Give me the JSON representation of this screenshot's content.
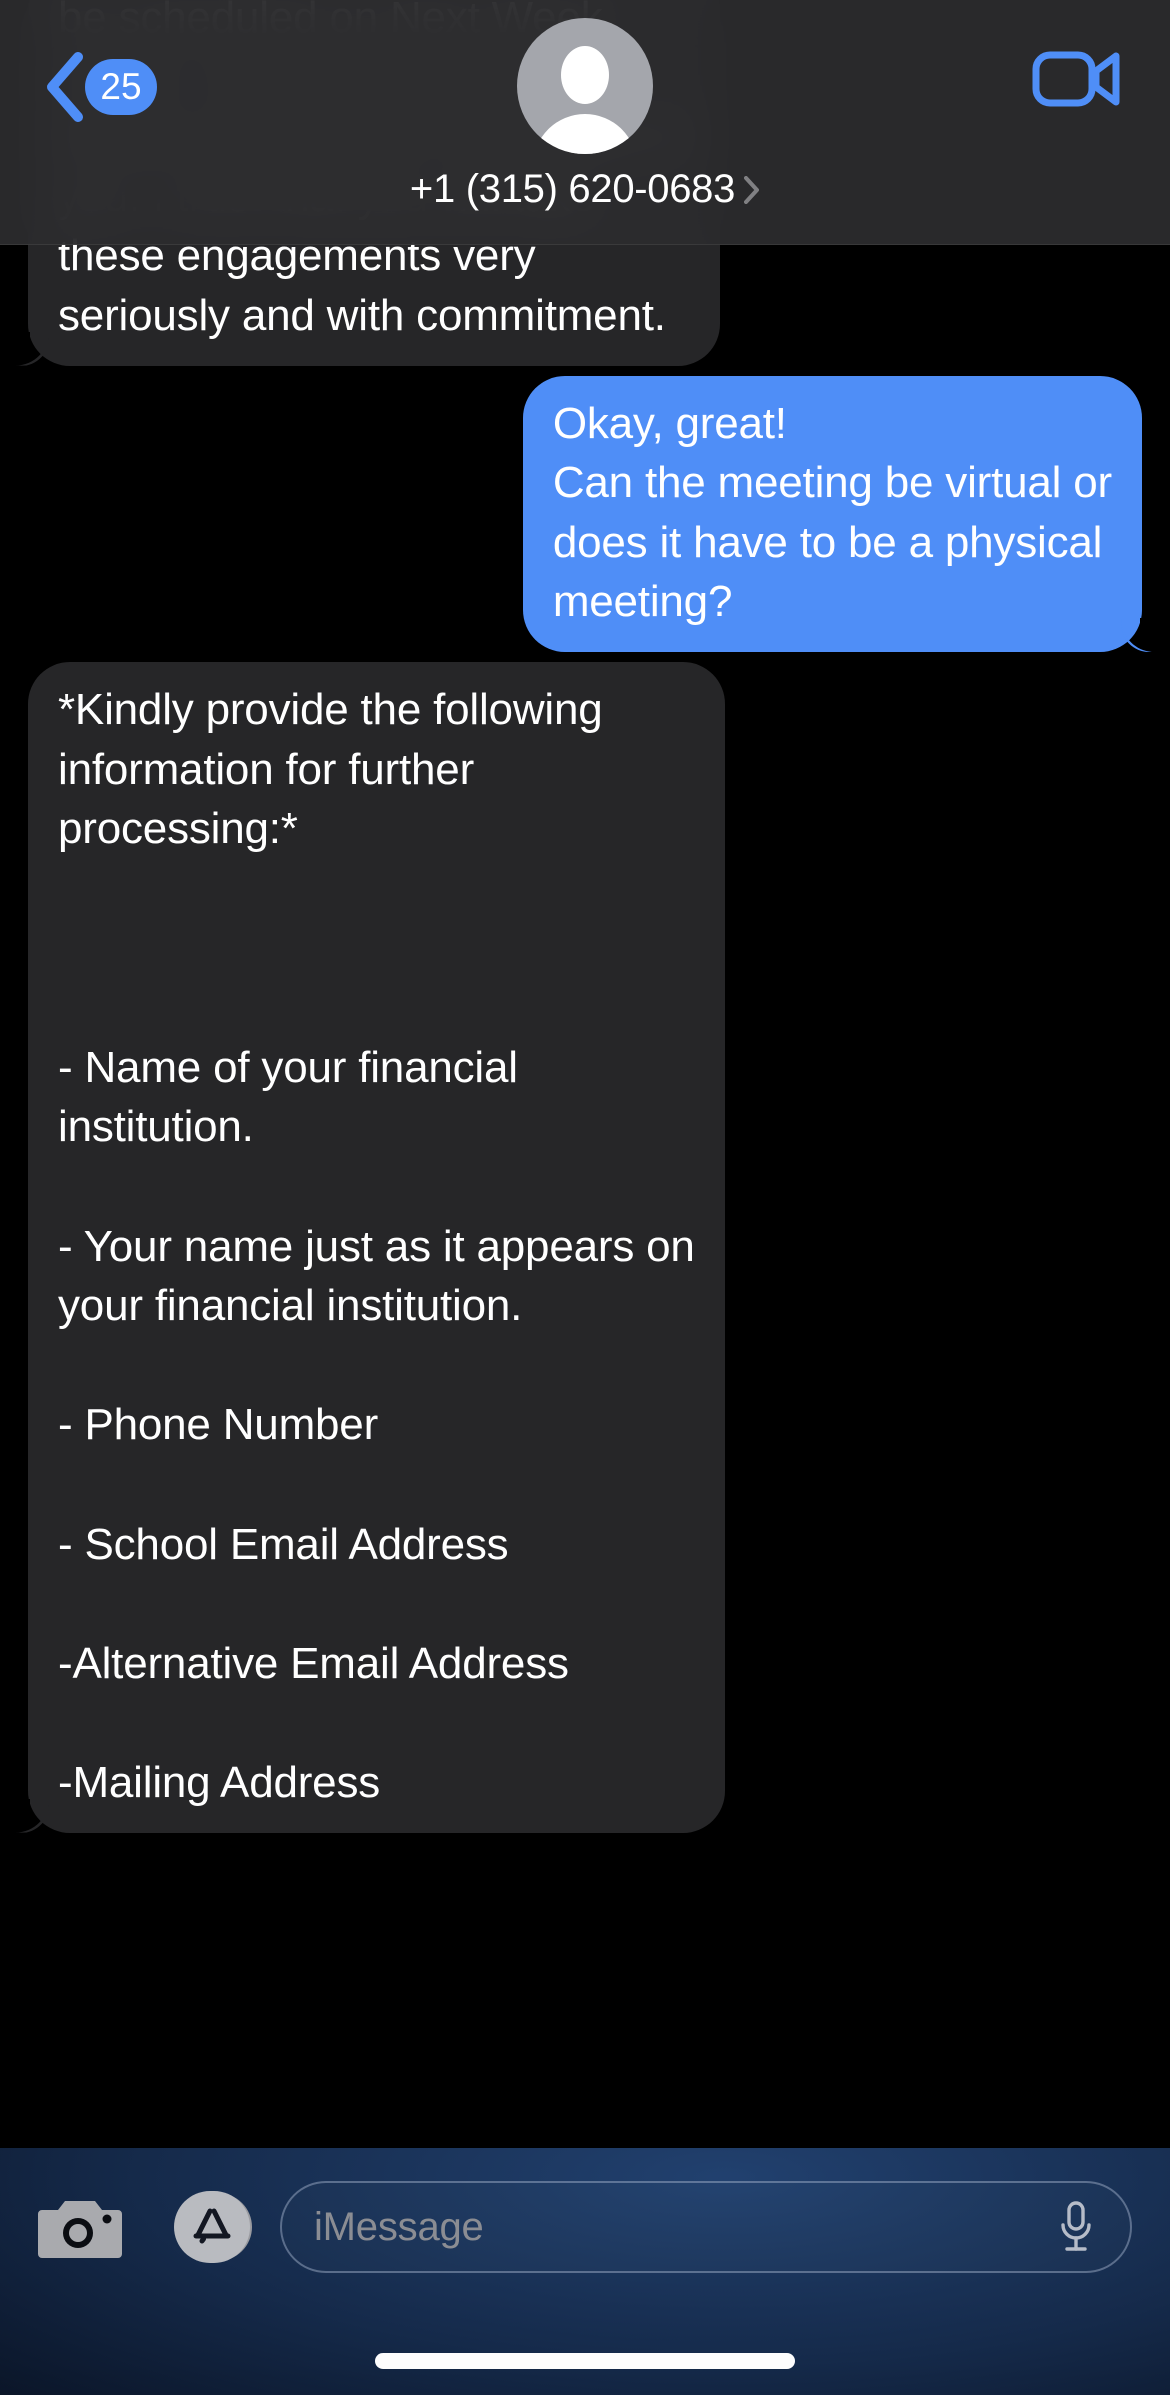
{
  "navbar": {
    "back_badge_count": "25",
    "back_icon": "chevron-left-icon",
    "contact_name": "+1 (315) 620-0683",
    "contact_chevron_icon": "chevron-right-icon",
    "avatar_icon": "default-contact-avatar",
    "facetime_icon": "video-camera-icon"
  },
  "messages": [
    {
      "direction": "incoming",
      "text": "be scheduled on Next Week\nwhere I shall provide more\ndetails about what is expected of\nyou. I trust that you will take\nthese engagements very\nseriously and with commitment."
    },
    {
      "direction": "outgoing",
      "text": "Okay, great!\nCan the meeting be virtual or\ndoes it have to be a physical\nmeeting?"
    },
    {
      "direction": "incoming",
      "text": "*Kindly provide the following\ninformation for further\nprocessing:*\n\n\n\n- Name of your financial\ninstitution.\n\n- Your name just as it appears on\nyour financial institution.\n\n- Phone Number\n\n- School Email Address\n\n-Alternative Email Address\n\n-Mailing Address"
    }
  ],
  "composer": {
    "camera_icon": "camera-icon",
    "appstore_icon": "app-store-icon",
    "placeholder": "iMessage",
    "mic_icon": "microphone-icon"
  },
  "colors": {
    "accent_blue": "#4f8ef7",
    "incoming_bubble": "#262628",
    "navbar_bg": "#2c2c2e",
    "page_bg": "#000000"
  }
}
